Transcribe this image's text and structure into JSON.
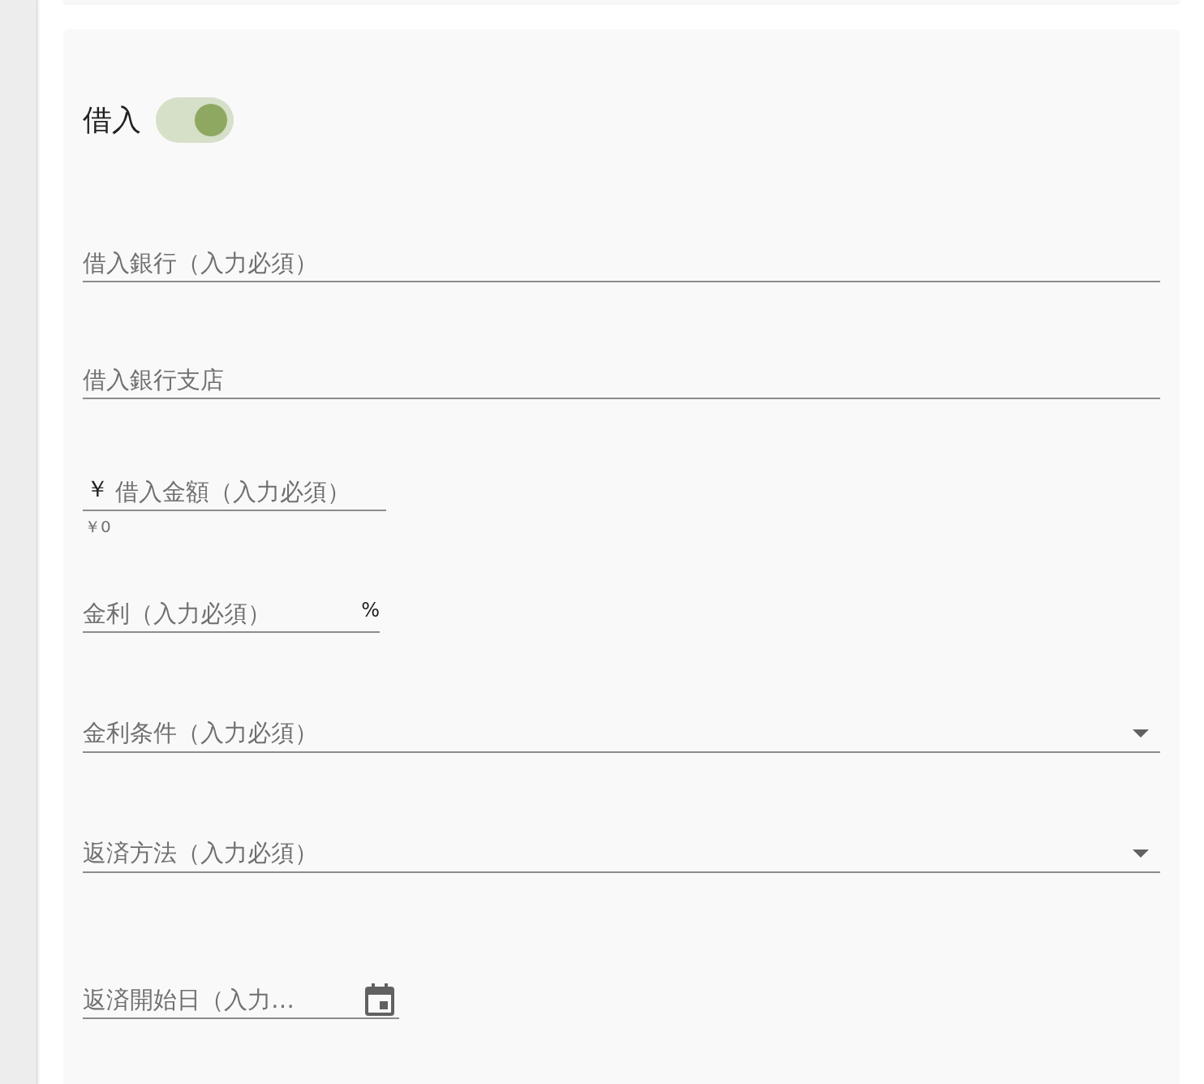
{
  "toggle": {
    "label": "借入",
    "on": true
  },
  "fields": [
    {
      "kind": "text",
      "placeholder": "借入銀行（入力必須）"
    },
    {
      "kind": "text",
      "placeholder": "借入銀行支店"
    },
    {
      "kind": "text",
      "placeholder": "借入金額（入力必須）",
      "prefix": "￥",
      "helper": "￥0"
    },
    {
      "kind": "text",
      "placeholder": "金利（入力必須）",
      "suffix": "%"
    },
    {
      "kind": "select",
      "placeholder": "金利条件（入力必須）"
    },
    {
      "kind": "select",
      "placeholder": "返済方法（入力必須）"
    },
    {
      "kind": "date",
      "placeholder": "返済開始日（入力…"
    }
  ]
}
